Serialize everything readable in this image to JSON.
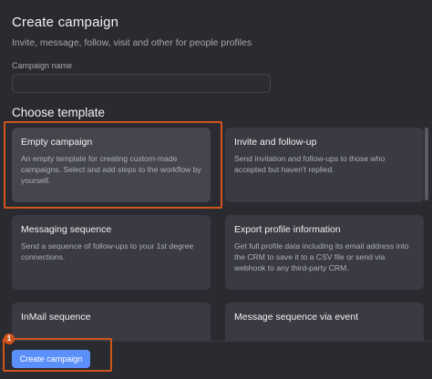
{
  "header": {
    "title": "Create campaign",
    "subtitle": "Invite, message, follow, visit and other for people profiles"
  },
  "campaign_name": {
    "label": "Campaign name",
    "value": "",
    "placeholder": ""
  },
  "templates": {
    "section_title": "Choose template",
    "items": [
      {
        "title": "Empty campaign",
        "description": "An empty template for creating custom-made campaigns. Select and add steps to the workflow by yourself."
      },
      {
        "title": "Invite and follow-up",
        "description": "Send invitation and follow-ups to those who accepted but haven't replied."
      },
      {
        "title": "Messaging sequence",
        "description": "Send a sequence of follow-ups to your 1st degree connections."
      },
      {
        "title": "Export profile information",
        "description": "Get full profile data including its email address into the CRM to save it to a CSV file or send via webhook to any third-party CRM."
      },
      {
        "title": "InMail sequence",
        "description": ""
      },
      {
        "title": "Message sequence via event",
        "description": ""
      }
    ]
  },
  "footer": {
    "create_label": "Create campaign"
  },
  "annotations": {
    "step_number": "1",
    "highlight_color": "#d2541a"
  },
  "colors": {
    "background": "#2a2b30",
    "card": "#3a3b42",
    "card_selected": "#45464d",
    "primary_button": "#5b8ff9"
  }
}
